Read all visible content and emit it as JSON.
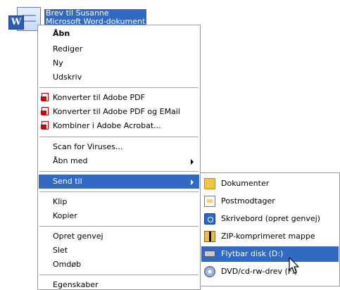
{
  "file": {
    "name": "Brev til Susanne",
    "type": "Microsoft Word-dokument",
    "icon": "word-document-icon"
  },
  "context_menu": {
    "items": [
      {
        "label": "Åbn",
        "bold": true
      },
      {
        "label": "Rediger"
      },
      {
        "label": "Ny"
      },
      {
        "label": "Udskriv"
      },
      {
        "label": "Konverter til Adobe PDF",
        "icon": "adobe-pdf-icon"
      },
      {
        "label": "Konverter til Adobe PDF og EMail",
        "icon": "adobe-pdf-email-icon"
      },
      {
        "label": "Kombiner i Adobe Acrobat...",
        "icon": "adobe-acrobat-icon"
      },
      {
        "label": "Scan for Viruses..."
      },
      {
        "label": "Åbn med",
        "submenu": true
      },
      {
        "label": "Send til",
        "submenu": true,
        "selected": true
      },
      {
        "label": "Klip"
      },
      {
        "label": "Kopier"
      },
      {
        "label": "Opret genvej"
      },
      {
        "label": "Slet"
      },
      {
        "label": "Omdøb"
      },
      {
        "label": "Egenskaber"
      }
    ]
  },
  "send_to_menu": {
    "items": [
      {
        "label": "Dokumenter",
        "icon": "folder-icon"
      },
      {
        "label": "Postmodtager",
        "icon": "mail-recipient-icon"
      },
      {
        "label": "Skrivebord (opret genvej)",
        "icon": "desktop-icon"
      },
      {
        "label": "ZIP-komprimeret mappe",
        "icon": "zip-folder-icon"
      },
      {
        "label": "Flytbar disk (D:)",
        "icon": "removable-disk-icon",
        "selected": true
      },
      {
        "label": "DVD/cd-rw-drev (F:)",
        "icon": "dvd-drive-icon"
      }
    ]
  },
  "colors": {
    "selection": "#316ac5",
    "menu_border": "#999999",
    "separator": "#a5a5a5"
  }
}
